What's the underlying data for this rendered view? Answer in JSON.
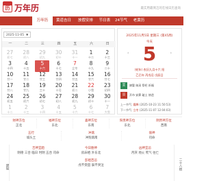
{
  "header": {
    "logo_glyph": "历",
    "title": "万年历",
    "slogan": "最实用最简洁的在线日历查询"
  },
  "nav": [
    "万年历",
    "黄道吉日",
    "放假安排",
    "节日表",
    "24节气",
    "老黄历"
  ],
  "calendar": {
    "month_select": "2025-11-05",
    "weekdays": [
      "一",
      "二",
      "三",
      "四",
      "五",
      "六",
      "日"
    ],
    "rows": [
      [
        {
          "d": "27",
          "s": "初七",
          "dim": true
        },
        {
          "d": "28",
          "s": "初八",
          "dim": true
        },
        {
          "d": "29",
          "s": "初九",
          "dim": true
        },
        {
          "d": "30",
          "s": "初十",
          "dim": true
        },
        {
          "d": "31",
          "s": "十一",
          "dim": true
        },
        {
          "d": "1",
          "s": "十二"
        },
        {
          "d": "2",
          "s": "十三"
        }
      ],
      [
        {
          "d": "3",
          "s": "十四"
        },
        {
          "d": "4",
          "s": "十五"
        },
        {
          "d": "5",
          "s": "十六",
          "sel": true
        },
        {
          "d": "6",
          "s": "十七"
        },
        {
          "d": "7",
          "s": "立冬",
          "red": true
        },
        {
          "d": "8",
          "s": "十九"
        },
        {
          "d": "9",
          "s": "二十"
        }
      ],
      [
        {
          "d": "10",
          "s": "廿一"
        },
        {
          "d": "11",
          "s": "廿二"
        },
        {
          "d": "12",
          "s": "廿三"
        },
        {
          "d": "13",
          "s": "廿四"
        },
        {
          "d": "14",
          "s": "廿五"
        },
        {
          "d": "15",
          "s": "廿六"
        },
        {
          "d": "16",
          "s": "廿七"
        }
      ],
      [
        {
          "d": "17",
          "s": "廿八"
        },
        {
          "d": "18",
          "s": "廿九"
        },
        {
          "d": "19",
          "s": "三十"
        },
        {
          "d": "20",
          "s": "十月"
        },
        {
          "d": "21",
          "s": "初二"
        },
        {
          "d": "22",
          "s": "小雪",
          "red": true
        },
        {
          "d": "23",
          "s": "初四"
        }
      ],
      [
        {
          "d": "24",
          "s": "初五"
        },
        {
          "d": "25",
          "s": "初六"
        },
        {
          "d": "26",
          "s": "初七"
        },
        {
          "d": "27",
          "s": "初八"
        },
        {
          "d": "28",
          "s": "初九"
        },
        {
          "d": "29",
          "s": "初十"
        },
        {
          "d": "30",
          "s": "十一"
        }
      ],
      [
        {
          "d": "1",
          "s": "十二",
          "dim": true
        },
        {
          "d": "2",
          "s": "十三",
          "dim": true
        },
        {
          "d": "3",
          "s": "十四",
          "dim": true
        },
        {
          "d": "4",
          "s": "十五",
          "dim": true
        },
        {
          "d": "5",
          "s": "十六",
          "dim": true
        },
        {
          "d": "6",
          "s": "十七",
          "dim": true
        },
        {
          "d": "7",
          "s": "大雪",
          "dim": true
        }
      ]
    ]
  },
  "side": {
    "date_line": "2025年11月5日 星期三 (第45周)",
    "today": "今天",
    "big_day": "5",
    "lunar": "(蛇年) 农历九月十六 阳",
    "ganzhi": "乙巳年 丙戌月 戊辰日",
    "yi_label": "宜",
    "yi_text": "嫁娶 纳采 祭祀 祈福",
    "ji_label": "忌",
    "ji_text": "开市 安葬 破土 修造",
    "prev_term_label": "上一节气:",
    "prev_term_name": "霜降",
    "prev_term_time": "(2025-10-23 11:50:53)",
    "next_term_label": "下一节气:",
    "next_term_name": "立冬",
    "next_term_time": "(2025-11-07 12:04:03)"
  },
  "info": {
    "row1": [
      {
        "k": "财神方位",
        "v": "正北"
      },
      {
        "k": "福神方位",
        "v": "东北"
      },
      {
        "k": "喜神方位",
        "v": "东南"
      },
      {
        "k": "阳贵神方位",
        "v": "东北"
      },
      {
        "k": "阴贵神方位",
        "v": "西南"
      }
    ],
    "row2": [
      {
        "k": "五行",
        "v": "城头土"
      },
      {
        "k": "冲煞",
        "v": "冲狗煞南"
      },
      {
        "k": "值神",
        "v": "司命"
      }
    ],
    "left_col": "建除",
    "right_col": "二十八宿",
    "bottom": [
      {
        "k": "吉神宜趋",
        "v": "阴德 三合 临日 时阴 五合 司命"
      },
      {
        "k": "今日胎神",
        "v": "房床栖 外东北"
      },
      {
        "k": "凶神宜忌",
        "v": "月厌 地火 死气 往亡"
      },
      {
        "k": "彭祖百忌",
        "v": "戊不受田 辰不哭泣"
      }
    ]
  }
}
